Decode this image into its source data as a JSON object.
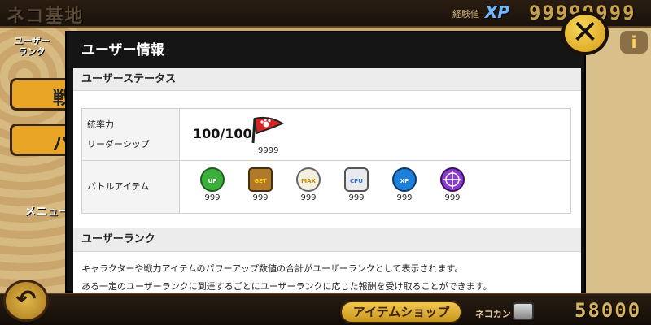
{
  "background": {
    "title": "ネコ基地",
    "xp_label": "経験値",
    "xp_badge": "XP",
    "xp_value": "99999999",
    "left_tab_label_1": "ユーザー",
    "left_tab_label_2": "ランク",
    "left_btn_1_glyph": "戦",
    "left_btn_2_glyph": "パ",
    "menu_label": "メニュー",
    "back_icon": "back-arrow-icon",
    "shop_label": "アイテムショップ",
    "catfood_label": "ネコカン",
    "catfood_value": "58000",
    "info_icon": "i"
  },
  "dialog": {
    "title": "ユーザー情報",
    "status_section": "ユーザーステータス",
    "leadership_label_1": "統率力",
    "leadership_label_2": "リーダーシップ",
    "leadership_value": "100/100",
    "flag_count": "9999",
    "battle_items_label": "バトルアイテム",
    "battle_items": [
      {
        "name": "speed-up",
        "icon_text": "SPEED UP",
        "count": "999",
        "color": "#3cae3c"
      },
      {
        "name": "treasure-radar",
        "icon_text": "GET",
        "count": "999",
        "color": "#b07a2a"
      },
      {
        "name": "rich-cat",
        "icon_text": "MAX",
        "count": "999",
        "color": "#d8c040"
      },
      {
        "name": "cat-cpu",
        "icon_text": "CPU",
        "count": "999",
        "color": "#9aa0a8"
      },
      {
        "name": "xp-up",
        "icon_text": "XP UP",
        "count": "999",
        "color": "#1e7fd8"
      },
      {
        "name": "sniper",
        "icon_text": "",
        "count": "999",
        "color": "#8a3ad0"
      }
    ],
    "rank_section": "ユーザーランク",
    "description_1": "キャラクターや戦力アイテムのパワーアップ数値の合計がユーザーランクとして表示されます。",
    "description_2": "ある一定のユーザーランクに到達するごとにユーザーランクに応じた報酬を受け取ることができます。",
    "close_icon": "close-icon"
  }
}
